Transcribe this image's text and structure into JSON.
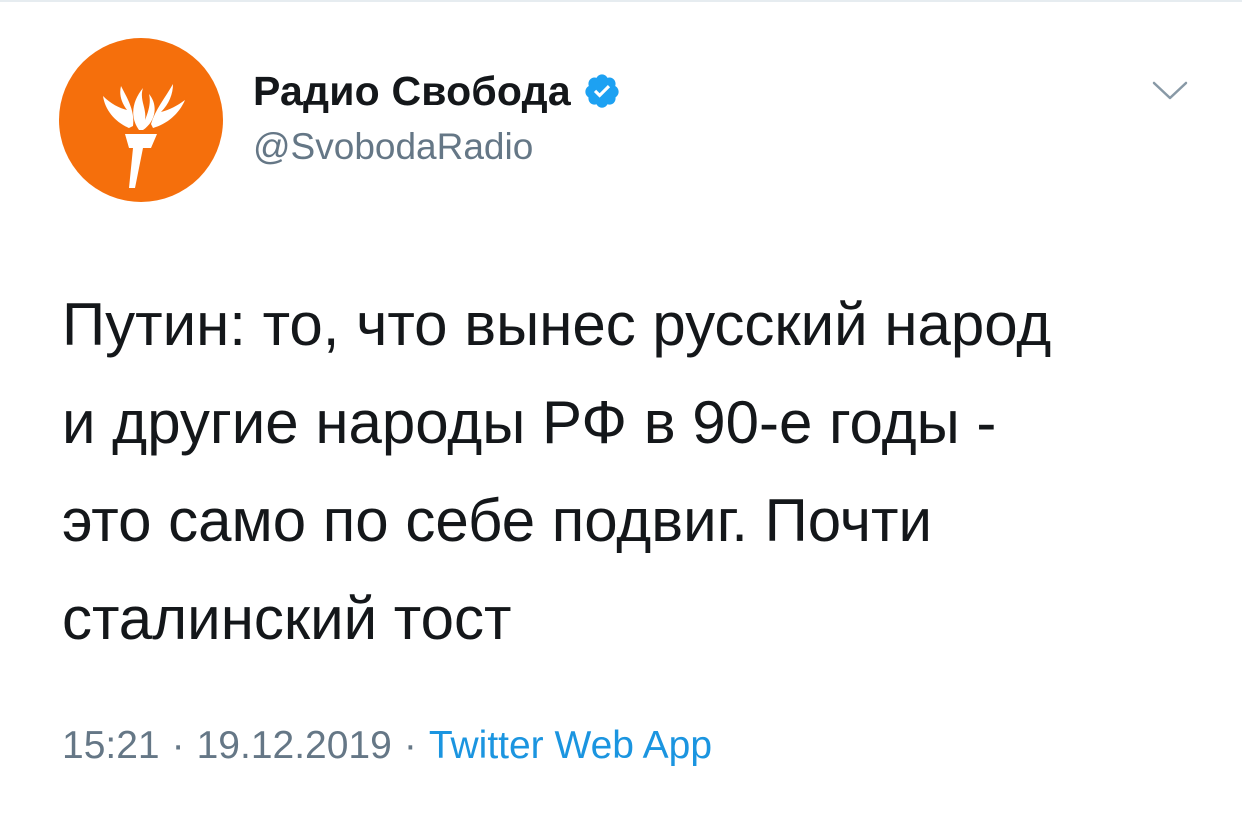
{
  "tweet": {
    "author": {
      "display_name": "Радио Свобода",
      "handle": "@SvobodaRadio",
      "verified": true,
      "avatar_icon": "torch-logo-icon",
      "avatar_color": "#f56f0c"
    },
    "text": "Путин: то, что вынес русский народ\nи другие народы РФ в 90-е годы -\nэто само по себе подвиг. Почти\nсталинский тост",
    "time": "15:21",
    "separator": "·",
    "date": "19.12.2019",
    "source": "Twitter Web App",
    "menu_icon": "chevron-down-icon"
  },
  "colors": {
    "text_primary": "#14171a",
    "text_secondary": "#657786",
    "link": "#1b95e0",
    "verified_badge": "#1da1f2"
  }
}
